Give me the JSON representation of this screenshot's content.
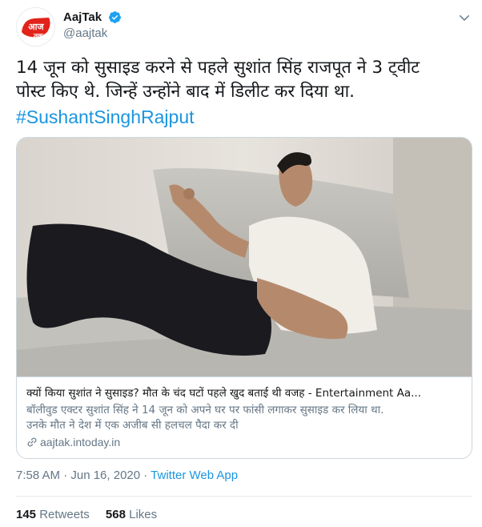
{
  "tweet": {
    "author": {
      "display_name": "AajTak",
      "handle": "@aajtak",
      "verified": true,
      "avatar_logo_text": "आज तक"
    },
    "text_lines": [
      "14 जून को सुसाइड करने से पहले सुशांत सिंह राजपूत ने 3 ट्वीट",
      "पोस्ट किए थे. जिन्हें उन्होंने बाद में डिलीट कर दिया था."
    ],
    "hashtag": "#SushantSinghRajput",
    "card": {
      "title": "क्यों किया सुशांत ने सुसाइड? मौत के चंद घटों पहले खुद बताई थी वजह - Entertainment Aa...",
      "description_lines": [
        "बॉलीवुड एक्टर सुशांत सिंह ने 14 जून को अपने घर पर फांसी लगाकर सुसाइड कर लिया था.",
        "उनके मौत ने देश में एक अजीब सी हलचल पैदा कर दी"
      ],
      "domain": "aajtak.intoday.in"
    },
    "timestamp": "7:58 AM · Jun 16, 2020 · ",
    "source": "Twitter Web App",
    "retweets_count": "145",
    "retweets_label": "Retweets",
    "likes_count": "568",
    "likes_label": "Likes"
  },
  "icons": {
    "verified": "verified-badge-icon",
    "caret": "chevron-down-icon",
    "link": "link-icon"
  },
  "colors": {
    "link_blue": "#1b95e0",
    "secondary_text": "#657786",
    "brand_red": "#e2231a"
  }
}
